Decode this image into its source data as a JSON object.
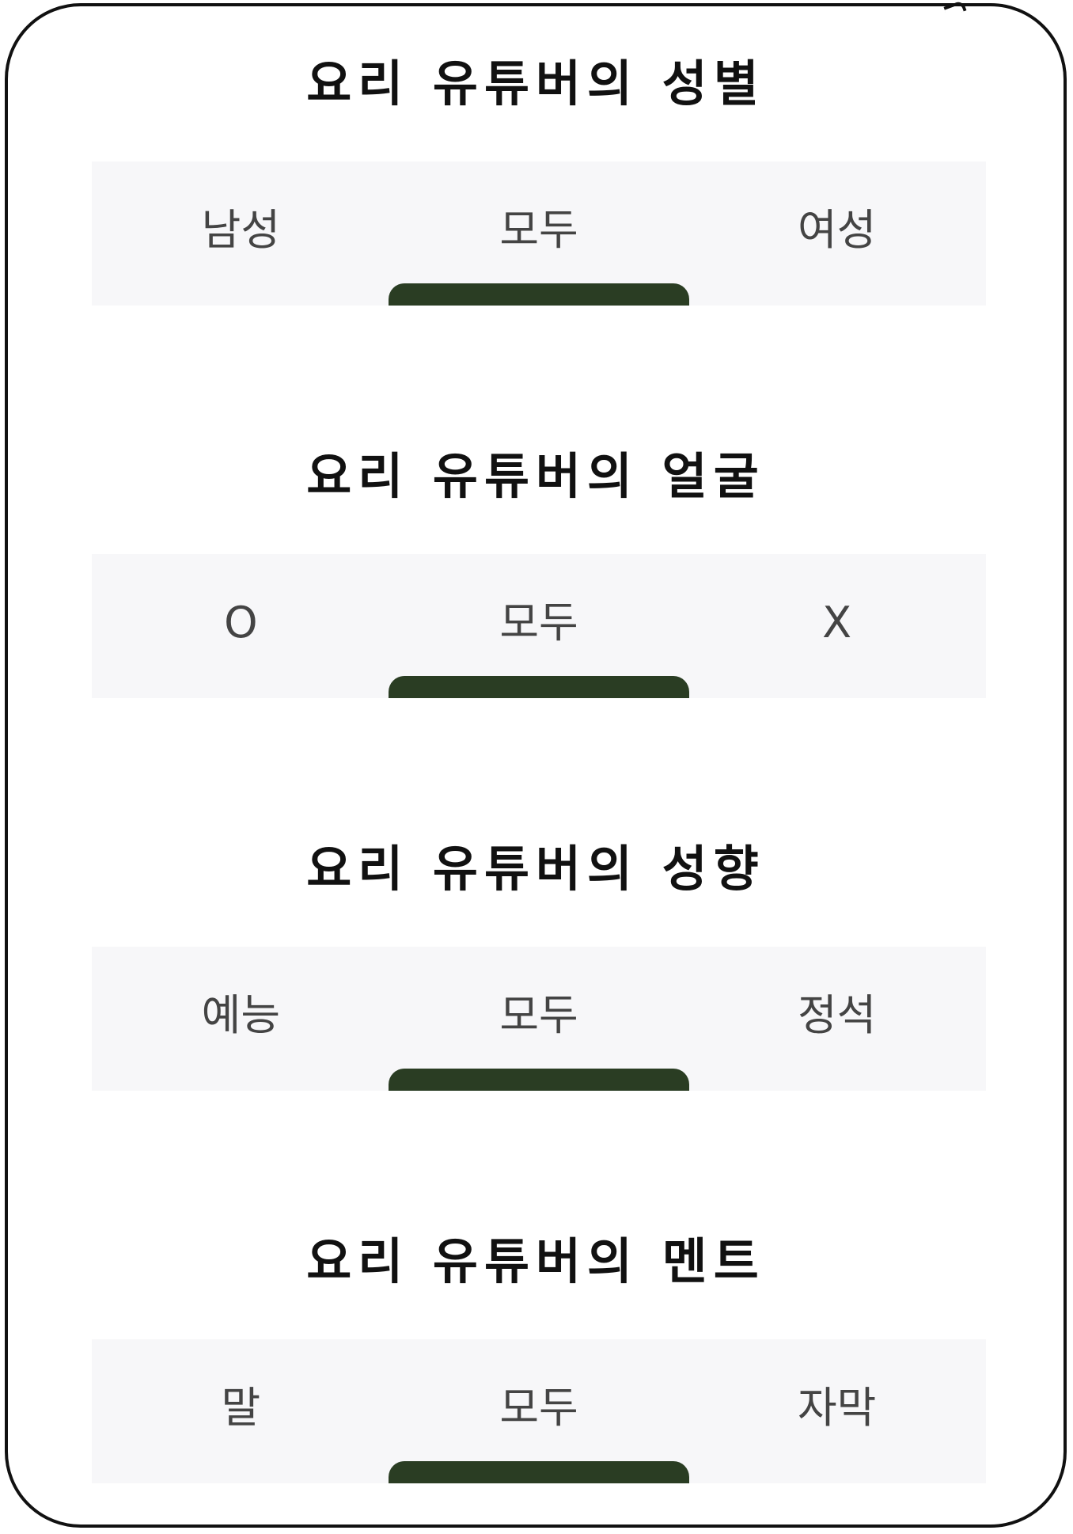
{
  "sections": [
    {
      "title": "요리 유튜버의 성별",
      "tabs": [
        {
          "label": "남성"
        },
        {
          "label": "모두"
        },
        {
          "label": "여성"
        }
      ],
      "selected_index": 1
    },
    {
      "title": "요리 유튜버의 얼굴",
      "tabs": [
        {
          "label": "O"
        },
        {
          "label": "모두"
        },
        {
          "label": "X"
        }
      ],
      "selected_index": 1
    },
    {
      "title": "요리 유튜버의 성향",
      "tabs": [
        {
          "label": "예능"
        },
        {
          "label": "모두"
        },
        {
          "label": "정석"
        }
      ],
      "selected_index": 1
    },
    {
      "title": "요리 유튜버의 멘트",
      "tabs": [
        {
          "label": "말"
        },
        {
          "label": "모두"
        },
        {
          "label": "자막"
        }
      ],
      "selected_index": 1
    }
  ],
  "colors": {
    "indicator": "#2a3d23",
    "tab_background": "#f7f7f9",
    "title_text": "#111111",
    "tab_text": "#444444"
  }
}
